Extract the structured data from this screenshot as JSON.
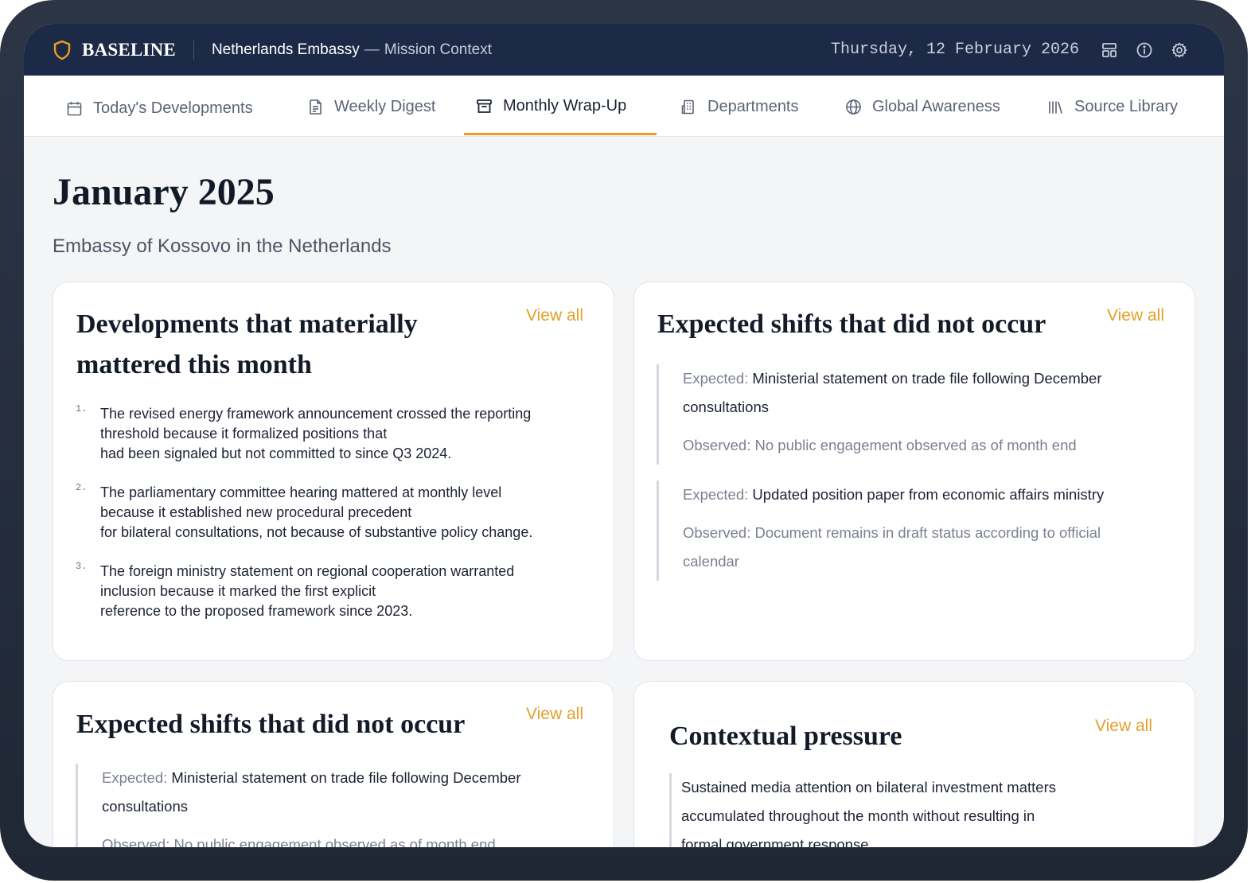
{
  "header": {
    "brand": "BASELINE",
    "context_main": "Netherlands Embassy",
    "context_dash": "—",
    "context_sub": "Mission Context",
    "date": "Thursday, 12 February 2026",
    "icons": [
      "layout-icon",
      "info-icon",
      "settings-icon"
    ]
  },
  "tabs": [
    {
      "label": "Today's Developments",
      "icon": "calendar-icon"
    },
    {
      "label": "Weekly Digest",
      "icon": "document-icon"
    },
    {
      "label": "Monthly Wrap-Up",
      "icon": "archive-icon",
      "active": true
    },
    {
      "label": "Departments",
      "icon": "building-icon"
    },
    {
      "label": "Global Awareness",
      "icon": "globe-icon"
    },
    {
      "label": "Source Library",
      "icon": "library-icon"
    }
  ],
  "page": {
    "title": "January 2025",
    "subtitle": "Embassy of Kossovo in the Netherlands"
  },
  "cards": {
    "developments": {
      "title_line1": "Developments that materially",
      "title_line2": "mattered this month",
      "view_all": "View all",
      "items": [
        {
          "num": "1.",
          "lines": [
            "The revised energy framework announcement crossed the reporting",
            "threshold because it formalized positions that",
            "had been signaled but not committed to since Q3 2024."
          ]
        },
        {
          "num": "2.",
          "lines": [
            "The parliamentary committee hearing mattered at monthly level",
            "because it established new procedural precedent",
            "for bilateral consultations, not because of substantive policy change."
          ]
        },
        {
          "num": "3.",
          "lines": [
            "The foreign ministry statement on regional cooperation warranted",
            "inclusion because it marked the first explicit",
            "reference to the proposed framework since 2023."
          ]
        }
      ]
    },
    "shifts_right": {
      "title": "Expected shifts that did not occur",
      "view_all": "View all",
      "items": [
        {
          "expected_label": "Expected:",
          "expected_line1": "Ministerial statement on trade file following December",
          "expected_line2": "consultations",
          "observed_line1": "Observed: No public engagement observed as of month end",
          "observed_line2": ""
        },
        {
          "expected_label": "Expected:",
          "expected_line1": "Updated position paper from economic affairs ministry",
          "expected_line2": "",
          "observed_line1": "Observed: Document remains in draft status according to official",
          "observed_line2": "calendar"
        }
      ]
    },
    "shifts_left": {
      "title": "Expected shifts that did not occur",
      "view_all": "View all",
      "items": [
        {
          "expected_label": "Expected:",
          "expected_line1": "Ministerial statement on trade file following December",
          "expected_line2": "consultations",
          "observed_line1": "Observed: No public engagement observed as of month end"
        }
      ]
    },
    "pressure": {
      "title": "Contextual pressure",
      "view_all": "View all",
      "lines": [
        "Sustained media attention on bilateral investment matters",
        "accumulated throughout the month without resulting in",
        "formal government response."
      ]
    }
  },
  "colors": {
    "frame": "#252e3d",
    "header_bg": "#1d2a47",
    "accent": "#e8a021",
    "page_bg": "#f4f5f7"
  }
}
